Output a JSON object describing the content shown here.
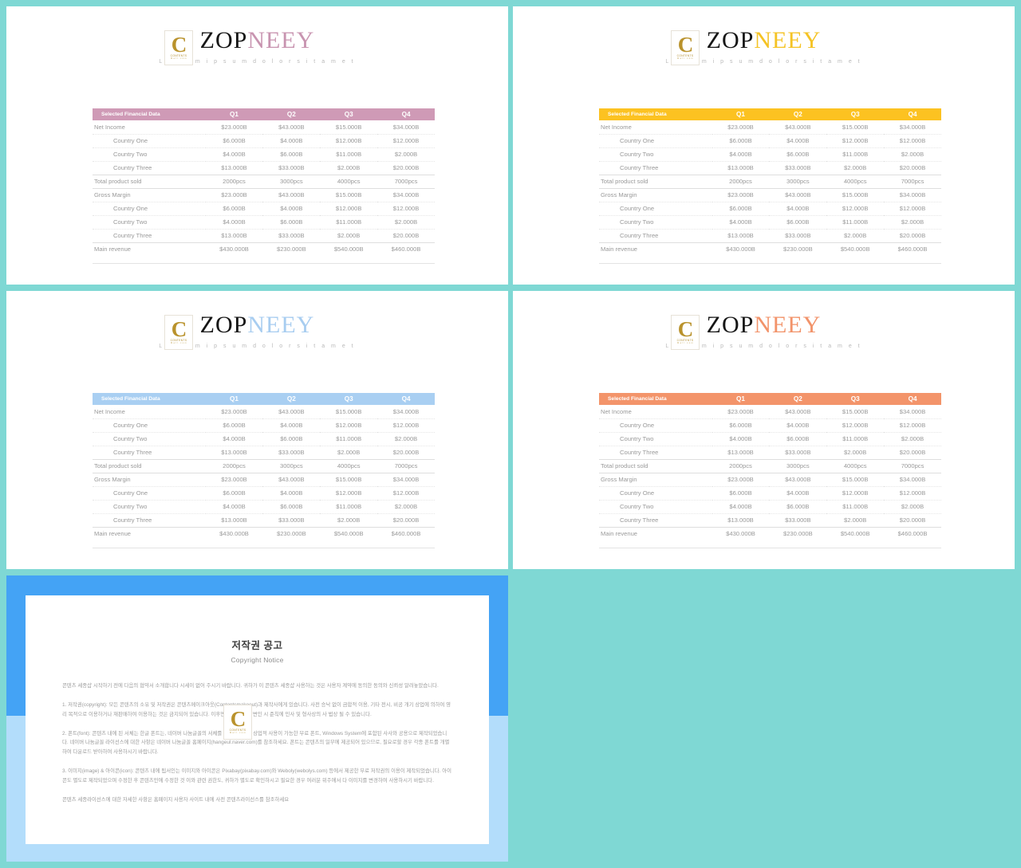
{
  "background_color": "#7fd8d4",
  "slides": [
    {
      "id": "slide-1",
      "accent": "#c894b0",
      "header_bg": "#cf9ab6",
      "brand": {
        "dark": "ZOP",
        "accent": "NEEY",
        "tagline": "L o r e m   i p s u m   d o l o r   s i t   a m e t"
      }
    },
    {
      "id": "slide-2",
      "accent": "#f5c324",
      "header_bg": "#fcc221",
      "brand": {
        "dark": "ZOP",
        "accent": "NEEY",
        "tagline": "L o r e m   i p s u m   d o l o r   s i t   a m e t"
      }
    },
    {
      "id": "slide-3",
      "accent": "#a8cdf0",
      "header_bg": "#a9cff2",
      "brand": {
        "dark": "ZOP",
        "accent": "NEEY",
        "tagline": "L o r e m   i p s u m   d o l o r   s i t   a m e t"
      }
    },
    {
      "id": "slide-4",
      "accent": "#f2936a",
      "header_bg": "#f3946a",
      "brand": {
        "dark": "ZOP",
        "accent": "NEEY",
        "tagline": "L o r e m   i p s u m   d o l o r   s i t   a m e t"
      }
    }
  ],
  "table": {
    "headers": [
      "Selected Financial Data",
      "Q1",
      "Q2",
      "Q3",
      "Q4"
    ],
    "rows": [
      {
        "label": "Net Income",
        "indent": false,
        "rule": "dotted",
        "values": [
          "$23.000B",
          "$43.000B",
          "$15.000B",
          "$34.000B"
        ]
      },
      {
        "label": "Country One",
        "indent": true,
        "rule": "dotted",
        "values": [
          "$6.000B",
          "$4.000B",
          "$12.000B",
          "$12.000B"
        ]
      },
      {
        "label": "Country Two",
        "indent": true,
        "rule": "dotted",
        "values": [
          "$4.000B",
          "$6.000B",
          "$11.000B",
          "$2.000B"
        ]
      },
      {
        "label": "Country Three",
        "indent": true,
        "rule": "solid-bottom",
        "values": [
          "$13.000B",
          "$33.000B",
          "$2.000B",
          "$20.000B"
        ]
      },
      {
        "label": "Total product sold",
        "indent": false,
        "rule": "solid-bottom",
        "values": [
          "2000pcs",
          "3000pcs",
          "4000pcs",
          "7000pcs"
        ]
      },
      {
        "label": "Gross Margin",
        "indent": false,
        "rule": "dotted",
        "values": [
          "$23.000B",
          "$43.000B",
          "$15.000B",
          "$34.000B"
        ]
      },
      {
        "label": "Country One",
        "indent": true,
        "rule": "dotted",
        "values": [
          "$6.000B",
          "$4.000B",
          "$12.000B",
          "$12.000B"
        ]
      },
      {
        "label": "Country Two",
        "indent": true,
        "rule": "dotted",
        "values": [
          "$4.000B",
          "$6.000B",
          "$11.000B",
          "$2.000B"
        ]
      },
      {
        "label": "Country Three",
        "indent": true,
        "rule": "solid-bottom",
        "values": [
          "$13.000B",
          "$33.000B",
          "$2.000B",
          "$20.000B"
        ]
      },
      {
        "label": "Main revenue",
        "indent": false,
        "rule": "none",
        "values": [
          "$430.000B",
          "$230.000B",
          "$540.000B",
          "$460.000B"
        ]
      }
    ]
  },
  "watermark": {
    "letter": "C",
    "line1": "CONTENTS",
    "line2": "M a l l  .  c o m"
  },
  "notice": {
    "frame_top_color": "#44a3f5",
    "frame_bottom_color": "#b3ddfb",
    "title_ko": "저작권 공고",
    "title_en": "Copyright Notice",
    "paragraphs": [
      "콘텐츠 세종샵 시작하기 전에 다음의 협약서 소개합니다 시세이 없어 주시기 바랍니다. 귀하가 이 콘텐츠 세종샵 사용하는 것은 사용자 계약에 동의한 동의와 신뢰성 알려놓았습니다.",
      "1. 저작권(copyright): 모든 콘텐츠의 소유 및 저작권은 콘텐츠메이크아웃(Contentsmakeout)과 제작사에게 있습니다. 사전 승낙 없이 금합적 이용, 기타 전시, 비공 개기 상업에 의하여 영리 목적으로 이용하거나 재판매하여 이용하는 것은 금지되어 있습니다. 이후면 교체 여부가 변인 시 준칙에 민사 및 형사상의 사 법상 될 수 있습니다.",
      "2. 폰트(font): 콘텐츠 내에 된 서체는 한글 폰트는, 네이버 나눔글꼴의 서체를 사용하였으며 상업적 사용이 가능한 무료 폰트, Windows System에 포함된 사사와 공용으로 제작되었습니다. 네이버 나눔글꼴 라이선스에 대한 사항은 네이버 나눔글꼴 홈페이지(hangeul.naver.com)를 참조하세요. 폰트는 콘텐츠의 일부에 제공되어 있으므로, 필요로할 경우 각종 폰트를 개별하여 다운로드 받아하여 사용하시기 바랍니다.",
      "3. 이미지(image) & 아이콘(icon): 콘텐츠 내에 됩서인는 이미지와 아이콘은 Pixabay(pixabay.com)와 Weboly(webolys.com) 등에서 제공한 무료 저작권의 이용이 제작되었습니다. 아이콘도 별도로 제작되었으며 수정한 후 콘텐츠만에 수정한 것 이와 관련 권한도, 귀하가 별도로 확인하시고 필요한 경우 여러분 위주에서 다 이미지를 변경하여 사용하시기 바랍니다.",
      "콘텐츠 세종라이선스에 대한 자세한 사항은 홈페이지 사용자 사이트 내에 사전 콘텐츠라이선스를 참조하세요"
    ]
  }
}
